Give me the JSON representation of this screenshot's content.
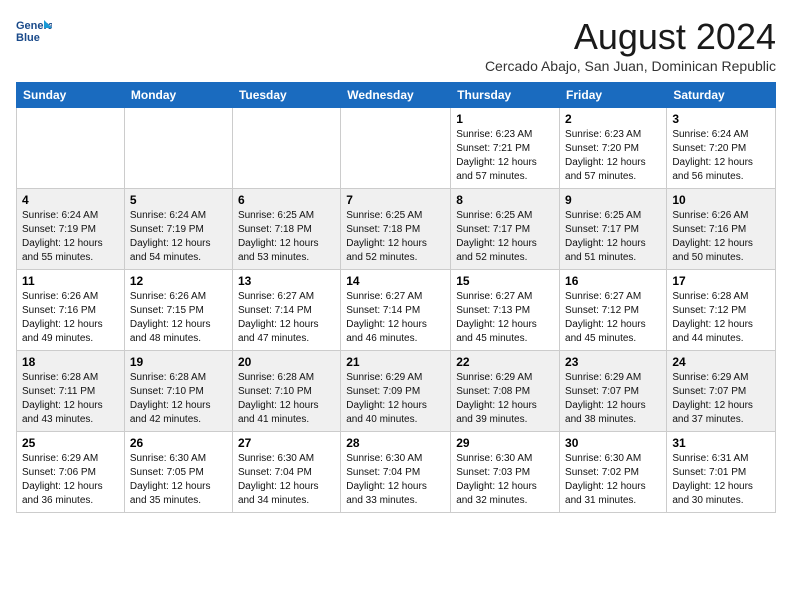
{
  "header": {
    "logo_line1": "General",
    "logo_line2": "Blue",
    "month_title": "August 2024",
    "subtitle": "Cercado Abajo, San Juan, Dominican Republic"
  },
  "days_of_week": [
    "Sunday",
    "Monday",
    "Tuesday",
    "Wednesday",
    "Thursday",
    "Friday",
    "Saturday"
  ],
  "weeks": [
    [
      {
        "day": "",
        "info": ""
      },
      {
        "day": "",
        "info": ""
      },
      {
        "day": "",
        "info": ""
      },
      {
        "day": "",
        "info": ""
      },
      {
        "day": "1",
        "info": "Sunrise: 6:23 AM\nSunset: 7:21 PM\nDaylight: 12 hours\nand 57 minutes."
      },
      {
        "day": "2",
        "info": "Sunrise: 6:23 AM\nSunset: 7:20 PM\nDaylight: 12 hours\nand 57 minutes."
      },
      {
        "day": "3",
        "info": "Sunrise: 6:24 AM\nSunset: 7:20 PM\nDaylight: 12 hours\nand 56 minutes."
      }
    ],
    [
      {
        "day": "4",
        "info": "Sunrise: 6:24 AM\nSunset: 7:19 PM\nDaylight: 12 hours\nand 55 minutes."
      },
      {
        "day": "5",
        "info": "Sunrise: 6:24 AM\nSunset: 7:19 PM\nDaylight: 12 hours\nand 54 minutes."
      },
      {
        "day": "6",
        "info": "Sunrise: 6:25 AM\nSunset: 7:18 PM\nDaylight: 12 hours\nand 53 minutes."
      },
      {
        "day": "7",
        "info": "Sunrise: 6:25 AM\nSunset: 7:18 PM\nDaylight: 12 hours\nand 52 minutes."
      },
      {
        "day": "8",
        "info": "Sunrise: 6:25 AM\nSunset: 7:17 PM\nDaylight: 12 hours\nand 52 minutes."
      },
      {
        "day": "9",
        "info": "Sunrise: 6:25 AM\nSunset: 7:17 PM\nDaylight: 12 hours\nand 51 minutes."
      },
      {
        "day": "10",
        "info": "Sunrise: 6:26 AM\nSunset: 7:16 PM\nDaylight: 12 hours\nand 50 minutes."
      }
    ],
    [
      {
        "day": "11",
        "info": "Sunrise: 6:26 AM\nSunset: 7:16 PM\nDaylight: 12 hours\nand 49 minutes."
      },
      {
        "day": "12",
        "info": "Sunrise: 6:26 AM\nSunset: 7:15 PM\nDaylight: 12 hours\nand 48 minutes."
      },
      {
        "day": "13",
        "info": "Sunrise: 6:27 AM\nSunset: 7:14 PM\nDaylight: 12 hours\nand 47 minutes."
      },
      {
        "day": "14",
        "info": "Sunrise: 6:27 AM\nSunset: 7:14 PM\nDaylight: 12 hours\nand 46 minutes."
      },
      {
        "day": "15",
        "info": "Sunrise: 6:27 AM\nSunset: 7:13 PM\nDaylight: 12 hours\nand 45 minutes."
      },
      {
        "day": "16",
        "info": "Sunrise: 6:27 AM\nSunset: 7:12 PM\nDaylight: 12 hours\nand 45 minutes."
      },
      {
        "day": "17",
        "info": "Sunrise: 6:28 AM\nSunset: 7:12 PM\nDaylight: 12 hours\nand 44 minutes."
      }
    ],
    [
      {
        "day": "18",
        "info": "Sunrise: 6:28 AM\nSunset: 7:11 PM\nDaylight: 12 hours\nand 43 minutes."
      },
      {
        "day": "19",
        "info": "Sunrise: 6:28 AM\nSunset: 7:10 PM\nDaylight: 12 hours\nand 42 minutes."
      },
      {
        "day": "20",
        "info": "Sunrise: 6:28 AM\nSunset: 7:10 PM\nDaylight: 12 hours\nand 41 minutes."
      },
      {
        "day": "21",
        "info": "Sunrise: 6:29 AM\nSunset: 7:09 PM\nDaylight: 12 hours\nand 40 minutes."
      },
      {
        "day": "22",
        "info": "Sunrise: 6:29 AM\nSunset: 7:08 PM\nDaylight: 12 hours\nand 39 minutes."
      },
      {
        "day": "23",
        "info": "Sunrise: 6:29 AM\nSunset: 7:07 PM\nDaylight: 12 hours\nand 38 minutes."
      },
      {
        "day": "24",
        "info": "Sunrise: 6:29 AM\nSunset: 7:07 PM\nDaylight: 12 hours\nand 37 minutes."
      }
    ],
    [
      {
        "day": "25",
        "info": "Sunrise: 6:29 AM\nSunset: 7:06 PM\nDaylight: 12 hours\nand 36 minutes."
      },
      {
        "day": "26",
        "info": "Sunrise: 6:30 AM\nSunset: 7:05 PM\nDaylight: 12 hours\nand 35 minutes."
      },
      {
        "day": "27",
        "info": "Sunrise: 6:30 AM\nSunset: 7:04 PM\nDaylight: 12 hours\nand 34 minutes."
      },
      {
        "day": "28",
        "info": "Sunrise: 6:30 AM\nSunset: 7:04 PM\nDaylight: 12 hours\nand 33 minutes."
      },
      {
        "day": "29",
        "info": "Sunrise: 6:30 AM\nSunset: 7:03 PM\nDaylight: 12 hours\nand 32 minutes."
      },
      {
        "day": "30",
        "info": "Sunrise: 6:30 AM\nSunset: 7:02 PM\nDaylight: 12 hours\nand 31 minutes."
      },
      {
        "day": "31",
        "info": "Sunrise: 6:31 AM\nSunset: 7:01 PM\nDaylight: 12 hours\nand 30 minutes."
      }
    ]
  ]
}
